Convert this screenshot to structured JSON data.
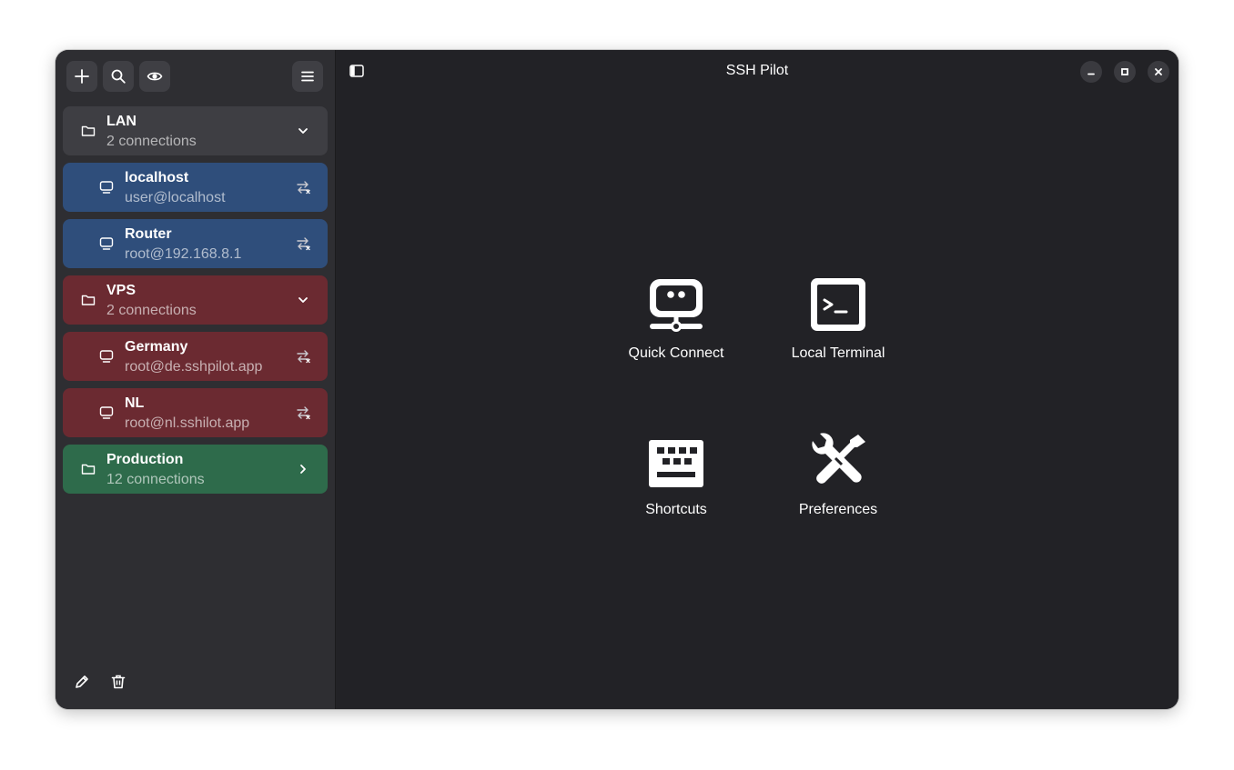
{
  "app": {
    "title": "SSH Pilot"
  },
  "sidebar": {
    "toolbar": [
      {
        "name": "add-button",
        "icon": "plus-icon"
      },
      {
        "name": "search-button",
        "icon": "search-icon"
      },
      {
        "name": "visibility-button",
        "icon": "eye-icon"
      },
      {
        "name": "menu-button",
        "icon": "hamburger-menu-icon"
      }
    ],
    "groups": [
      {
        "name": "LAN",
        "count_label": "2 connections",
        "color": "#3e3e43",
        "expanded": true,
        "icon": "folder-icon",
        "chevron": "chevron-down-icon",
        "hosts": [
          {
            "name": "localhost",
            "address": "user@localhost",
            "color": "#2f4e7b"
          },
          {
            "name": "Router",
            "address": "root@192.168.8.1",
            "color": "#2f4e7b"
          }
        ]
      },
      {
        "name": "VPS",
        "count_label": "2 connections",
        "color": "#6b2a31",
        "expanded": true,
        "icon": "folder-icon",
        "chevron": "chevron-down-icon",
        "hosts": [
          {
            "name": "Germany",
            "address": "root@de.sshpilot.app",
            "color": "#6b2a31"
          },
          {
            "name": "NL",
            "address": "root@nl.sshilot.app",
            "color": "#6b2a31"
          }
        ]
      },
      {
        "name": "Production",
        "count_label": "12 connections",
        "color": "#2e6b4b",
        "expanded": false,
        "icon": "folder-icon",
        "chevron": "chevron-right-icon",
        "hosts": []
      }
    ],
    "bottom": [
      {
        "name": "edit-button",
        "icon": "pencil-icon"
      },
      {
        "name": "delete-button",
        "icon": "trash-icon"
      }
    ]
  },
  "main": {
    "tiles": [
      {
        "label": "Quick Connect",
        "icon": "quick-connect-icon"
      },
      {
        "label": "Local Terminal",
        "icon": "terminal-icon"
      },
      {
        "label": "Shortcuts",
        "icon": "keyboard-icon"
      },
      {
        "label": "Preferences",
        "icon": "tools-icon"
      }
    ]
  }
}
